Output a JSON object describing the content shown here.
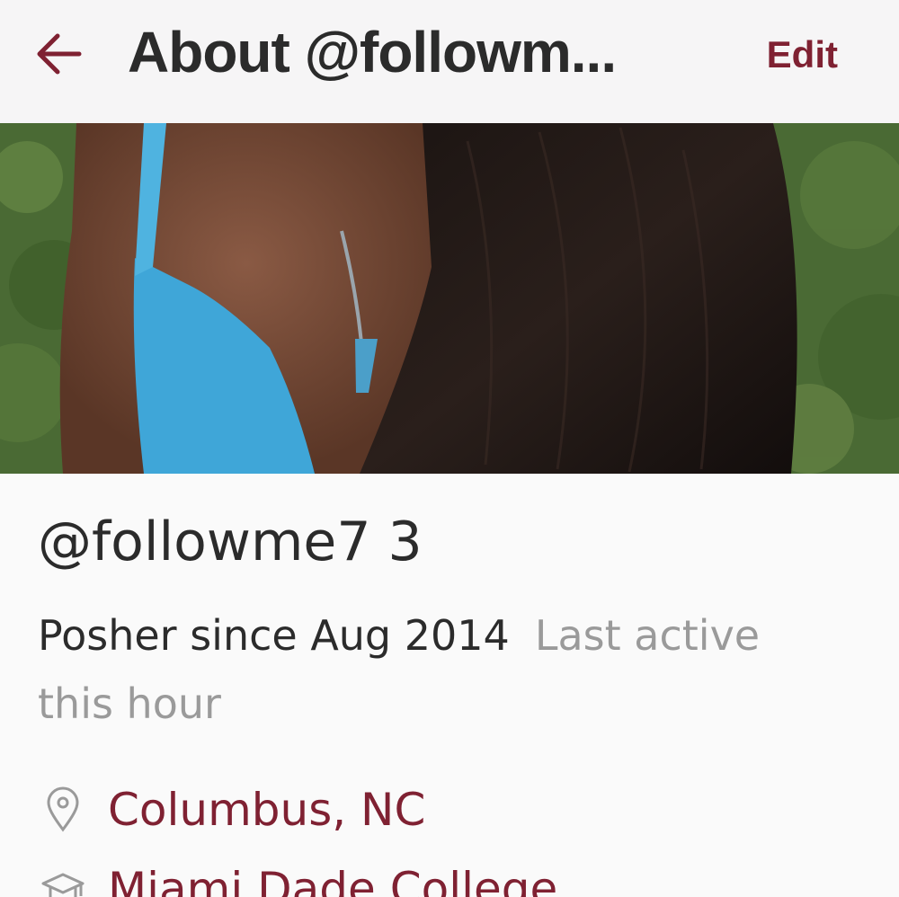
{
  "header": {
    "back_icon": "arrow-left-icon",
    "title": "About @followm...",
    "edit_label": "Edit",
    "accent_color": "#7f2132"
  },
  "profile": {
    "username": "@followme7 3",
    "posher_since": "Posher since Aug 2014",
    "last_active": "Last active this hour",
    "location": {
      "icon": "map-pin-icon",
      "text": "Columbus, NC"
    },
    "school": {
      "icon": "graduation-cap-icon",
      "text": "Miami Dade College"
    }
  }
}
